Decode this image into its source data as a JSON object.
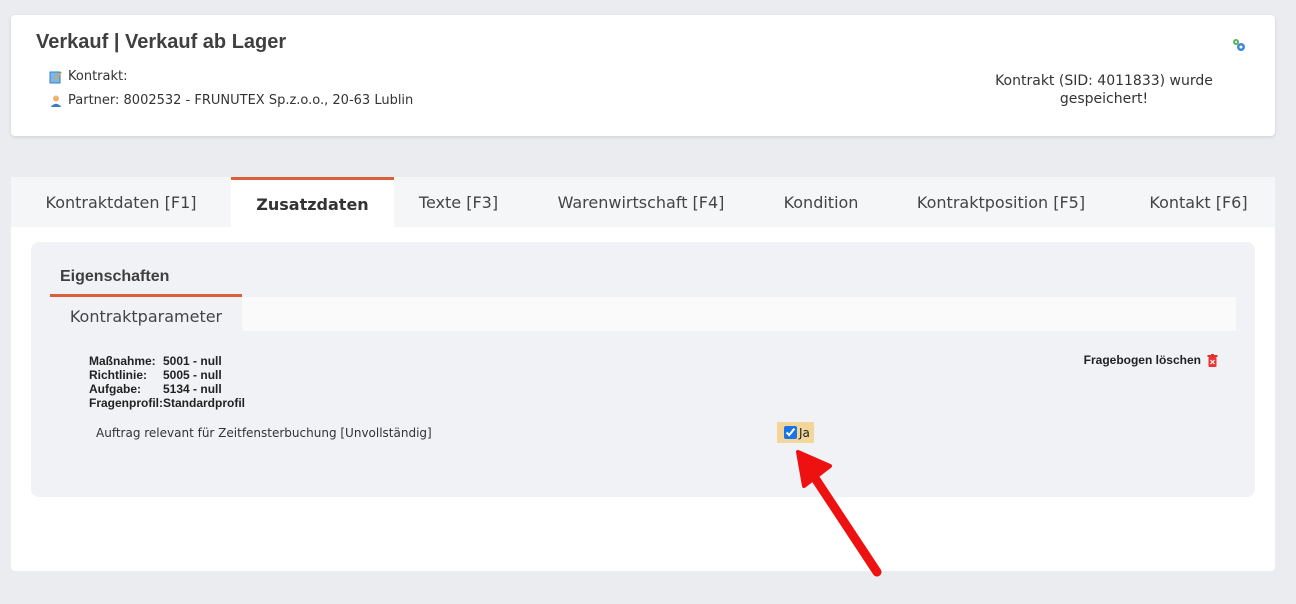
{
  "header": {
    "title": "Verkauf | Verkauf ab Lager",
    "contract_label": "Kontrakt:",
    "partner_text": "Partner: 8002532 - FRUNUTEX Sp.z.o.o., 20-63 Lublin",
    "status_message": "Kontrakt (SID: 4011833) wurde gespeichert!",
    "icons": [
      "contract-edit-icon",
      "partner-person-icon",
      "settings-gears-icon"
    ]
  },
  "tabs": [
    {
      "label": "Kontraktdaten [F1]"
    },
    {
      "label": "Zusatzdaten",
      "active": true
    },
    {
      "label": "Texte [F3]"
    },
    {
      "label": "Warenwirtschaft [F4]"
    },
    {
      "label": "Kondition"
    },
    {
      "label": "Kontraktposition [F5]"
    },
    {
      "label": "Kontakt [F6]"
    }
  ],
  "properties": {
    "section_title": "Eigenschaften",
    "subtab": "Kontraktparameter",
    "params": [
      {
        "label": "Maßnahme:",
        "value": "5001 - null"
      },
      {
        "label": "Richtlinie:",
        "value": "5005 - null"
      },
      {
        "label": "Aufgabe:",
        "value": "5134 - null"
      },
      {
        "label": "Fragenprofil:",
        "value": "Standardprofil"
      }
    ],
    "delete_label": "Fragebogen löschen",
    "relevant_label": "Auftrag relevant für Zeitfensterbuchung [Unvollständig]",
    "checkbox_label": "Ja",
    "checkbox_checked": true
  },
  "colors": {
    "accent": "#d9603b",
    "highlight": "#f3d69a",
    "arrow": "#ee1111"
  }
}
